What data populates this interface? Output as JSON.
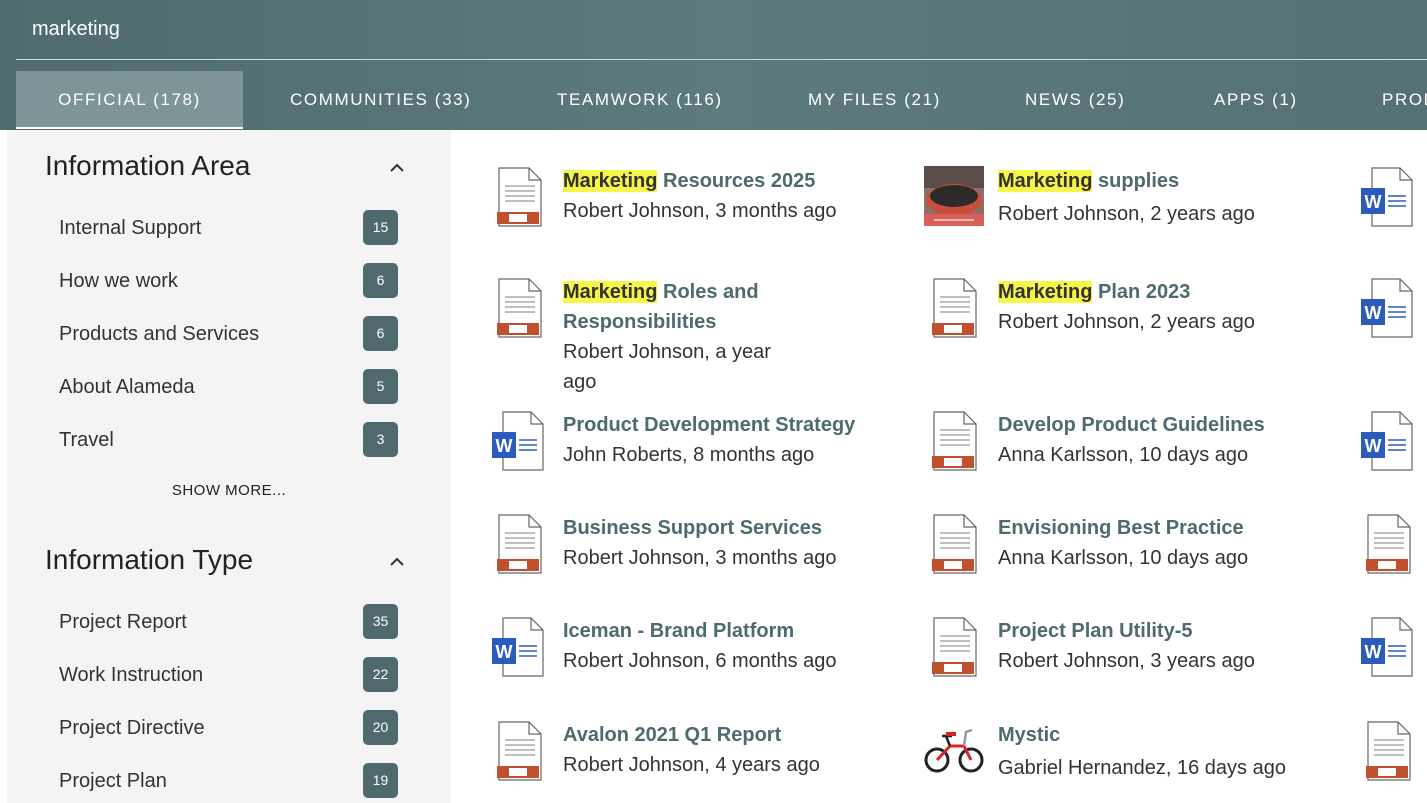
{
  "search": {
    "value": "marketing"
  },
  "tabs": [
    {
      "label": "OFFICIAL (178)"
    },
    {
      "label": "COMMUNITIES (33)"
    },
    {
      "label": "TEAMWORK (116)"
    },
    {
      "label": "MY FILES (21)"
    },
    {
      "label": "NEWS (25)"
    },
    {
      "label": "APPS (1)"
    },
    {
      "label": "PROD"
    }
  ],
  "facets": {
    "area": {
      "title": "Information Area",
      "items": [
        {
          "label": "Internal Support",
          "count": "15"
        },
        {
          "label": "How we work",
          "count": "6"
        },
        {
          "label": "Products and Services",
          "count": "6"
        },
        {
          "label": "About Alameda",
          "count": "5"
        },
        {
          "label": "Travel",
          "count": "3"
        }
      ],
      "show_more": "SHOW MORE..."
    },
    "type": {
      "title": "Information Type",
      "items": [
        {
          "label": "Project Report",
          "count": "35"
        },
        {
          "label": "Work Instruction",
          "count": "22"
        },
        {
          "label": "Project Directive",
          "count": "20"
        },
        {
          "label": "Project Plan",
          "count": "19"
        }
      ]
    }
  },
  "results": {
    "col1": [
      {
        "highlight": "Marketing",
        "title": " Resources 2025",
        "meta": "Robert Johnson, 3 months ago",
        "icon": "pdf-document-icon"
      },
      {
        "highlight": "Marketing",
        "title": " Roles and Responsibilities",
        "meta": "Robert Johnson, a year ago",
        "icon": "pdf-document-icon"
      },
      {
        "highlight": "",
        "title": "Product Development Strategy",
        "meta": "John Roberts, 8 months ago",
        "icon": "word-document-icon"
      },
      {
        "highlight": "",
        "title": "Business Support Services",
        "meta": "Robert Johnson, 3 months ago",
        "icon": "pdf-document-icon"
      },
      {
        "highlight": "",
        "title": "Iceman - Brand Platform",
        "meta": "Robert Johnson, 6 months ago",
        "icon": "word-document-icon"
      },
      {
        "highlight": "",
        "title": "Avalon 2021 Q1 Report",
        "meta": "Robert Johnson, 4 years ago",
        "icon": "pdf-document-icon"
      }
    ],
    "col2": [
      {
        "highlight": "Marketing",
        "title": " supplies",
        "meta": "Robert Johnson, 2 years ago",
        "icon": "image-thumbnail"
      },
      {
        "highlight": "Marketing",
        "title": " Plan 2023",
        "meta": "Robert Johnson, 2 years ago",
        "icon": "pdf-document-icon"
      },
      {
        "highlight": "",
        "title": "Develop Product Guidelines",
        "meta": "Anna Karlsson, 10 days ago",
        "icon": "pdf-document-icon"
      },
      {
        "highlight": "",
        "title": "Envisioning Best Practice",
        "meta": "Anna Karlsson, 10 days ago",
        "icon": "pdf-document-icon"
      },
      {
        "highlight": "",
        "title": "Project Plan Utility-5",
        "meta": "Robert Johnson, 3 years ago",
        "icon": "pdf-document-icon"
      },
      {
        "highlight": "",
        "title": "Mystic",
        "meta": "Gabriel Hernandez, 16 days ago",
        "icon": "bike-thumbnail"
      }
    ],
    "col3_icons": [
      "word-document-icon",
      "word-document-icon",
      "word-document-icon",
      "pdf-document-icon",
      "word-document-icon",
      "pdf-document-icon"
    ]
  },
  "colors": {
    "header": "#557176",
    "accent": "#4d6a6e",
    "highlight": "#f6f54a",
    "pdf_accent": "#c0512f",
    "word_blue": "#2b5cbc"
  }
}
